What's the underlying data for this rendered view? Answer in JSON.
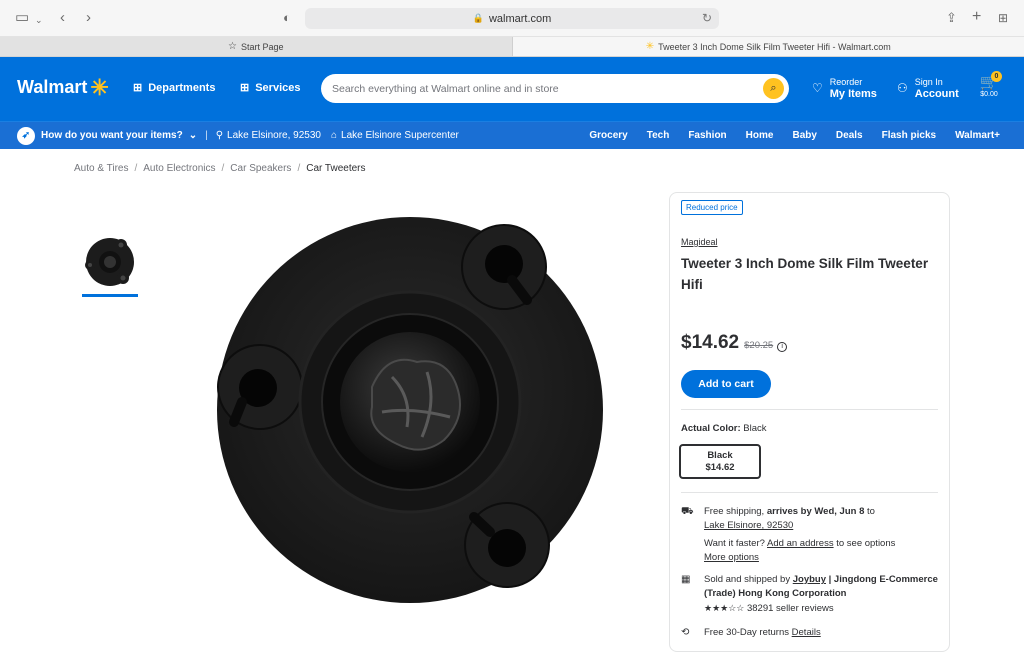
{
  "browser": {
    "url": "walmart.com",
    "tabs": [
      {
        "label": "Start Page"
      },
      {
        "label": "Tweeter 3 Inch Dome Silk Film Tweeter Hifi - Walmart.com"
      }
    ]
  },
  "header": {
    "logo": "Walmart",
    "departments": "Departments",
    "services": "Services",
    "search_placeholder": "Search everything at Walmart online and in store",
    "reorder_top": "Reorder",
    "reorder_bottom": "My Items",
    "signin_top": "Sign In",
    "signin_bottom": "Account",
    "cart_count": "0",
    "cart_total": "$0.00"
  },
  "subnav": {
    "how_do": "How do you want your items?",
    "location": "Lake Elsinore, 92530",
    "store": "Lake Elsinore Supercenter",
    "links": [
      "Grocery",
      "Tech",
      "Fashion",
      "Home",
      "Baby",
      "Deals",
      "Flash picks",
      "Walmart+"
    ]
  },
  "breadcrumb": [
    "Auto & Tires",
    "Auto Electronics",
    "Car Speakers",
    "Car Tweeters"
  ],
  "product": {
    "tag": "Reduced price",
    "brand": "Magideal",
    "title": "Tweeter 3 Inch Dome Silk Film Tweeter Hifi",
    "price": "$14.62",
    "was_price": "$20.25",
    "add_to_cart": "Add to cart",
    "color_label": "Actual Color:",
    "color_value": "Black",
    "swatch_name": "Black",
    "swatch_price": "$14.62"
  },
  "fulfillment": {
    "ship_a": "Free shipping, ",
    "ship_b": "arrives by Wed, Jun 8",
    "ship_c": " to",
    "ship_loc": "Lake Elsinore, 92530",
    "faster": "Want it faster?",
    "add_address": "Add an address",
    "see_options": " to see options",
    "more_options": "More options",
    "sold_prefix": "Sold and shipped by ",
    "seller": "Joybuy",
    "seller_full": " | Jingdong E-Commerce (Trade) Hong Kong Corporation",
    "stars": "★★★☆☆",
    "reviews": "38291 seller reviews",
    "returns": "Free 30-Day returns",
    "details": "Details"
  }
}
